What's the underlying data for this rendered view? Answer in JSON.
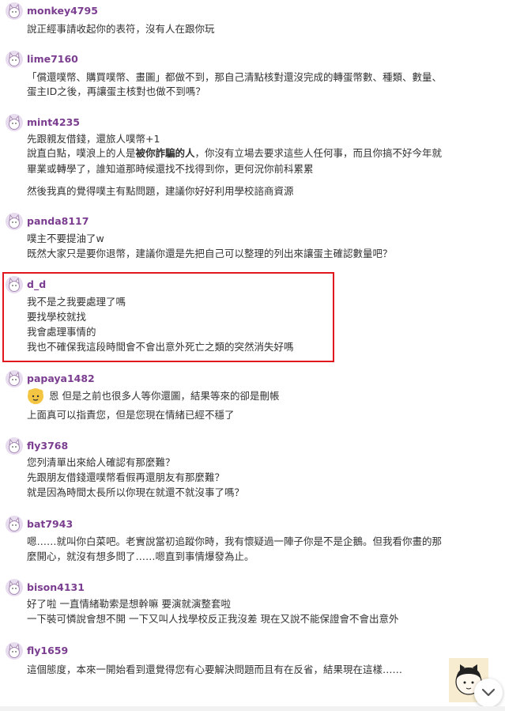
{
  "comments": [
    {
      "user": "monkey4795",
      "lines": [
        "說正經事請收起你的表符，沒有人在跟你玩"
      ]
    },
    {
      "user": "lime7160",
      "lines": [
        "「償還噗幣、購買噗幣、畫圖」都做不到，那自己清點核對還沒完成的轉蛋幣數、種類、數量、",
        "蛋主ID之後，再讓蛋主核對也做不到嗎？"
      ]
    },
    {
      "user": "mint4235",
      "lines": [
        "先跟親友借錢，還旅人噗幣+1",
        "說直白點，噗浪上的人是",
        "被你詐騙的人",
        "，你沒有立場去要求這些人任何事，而且你搞不好今年就",
        "畢業或轉學了，誰知道那時候還找不找得到你，更何況你前科累累",
        "然後我真的覺得噗主有點問題，建議你好好利用學校諮商資源"
      ]
    },
    {
      "user": "panda8117",
      "lines": [
        "噗主不要提油了w",
        "既然大家只是要你退幣，建議你還是先把自己可以整理的列出來讓蛋主確認數量吧？"
      ]
    },
    {
      "user": "d_d",
      "lines": [
        "我不是之我要處理了嗎",
        "要找學校就找",
        "我會處理事情的",
        "我也不確保我這段時間會不會出意外死亡之類的突然消失好嗎"
      ]
    },
    {
      "user": "papaya1482",
      "lines": [
        "恩 但是之前也很多人等你還圖，結果等來的卻是刪帳",
        "上面真可以指責您，但是您現在情緒已經不穩了"
      ]
    },
    {
      "user": "fly3768",
      "lines": [
        "您列清單出來給人確認有那麼難？",
        "先跟朋友借錢還噗幣看假再還朋友有那麼難？",
        "就是因為時間太長所以你現在就還不就沒事了嗎？"
      ]
    },
    {
      "user": "bat7943",
      "lines": [
        "嗯……就叫你白菜吧。老實說當初追蹤你時，我有懷疑過一陣子你是不是企鵝。但我看你畫的那",
        "麼開心，就沒有想多問了……嗯直到事情爆發為止。"
      ]
    },
    {
      "user": "bison4131",
      "lines": [
        "好了啦 一直情緒勒索是想幹嘛 要演就演整套啦",
        "一下裝可憐說會想不開 一下又叫人找學校反正我沒差 現在又說不能保證會不會出意外"
      ]
    },
    {
      "user": "fly1659",
      "lines": [
        "這個態度，本來一開始看到還覺得您有心要解決問題而且有在反省，結果現在這樣……"
      ]
    }
  ],
  "colors": {
    "username": "#7a3d8f",
    "highlight": "#e0181e",
    "avatar_bg": "#e8dcef"
  },
  "icons": {
    "avatar": "cat-avatar-icon",
    "scroll": "chevron-down-icon"
  }
}
